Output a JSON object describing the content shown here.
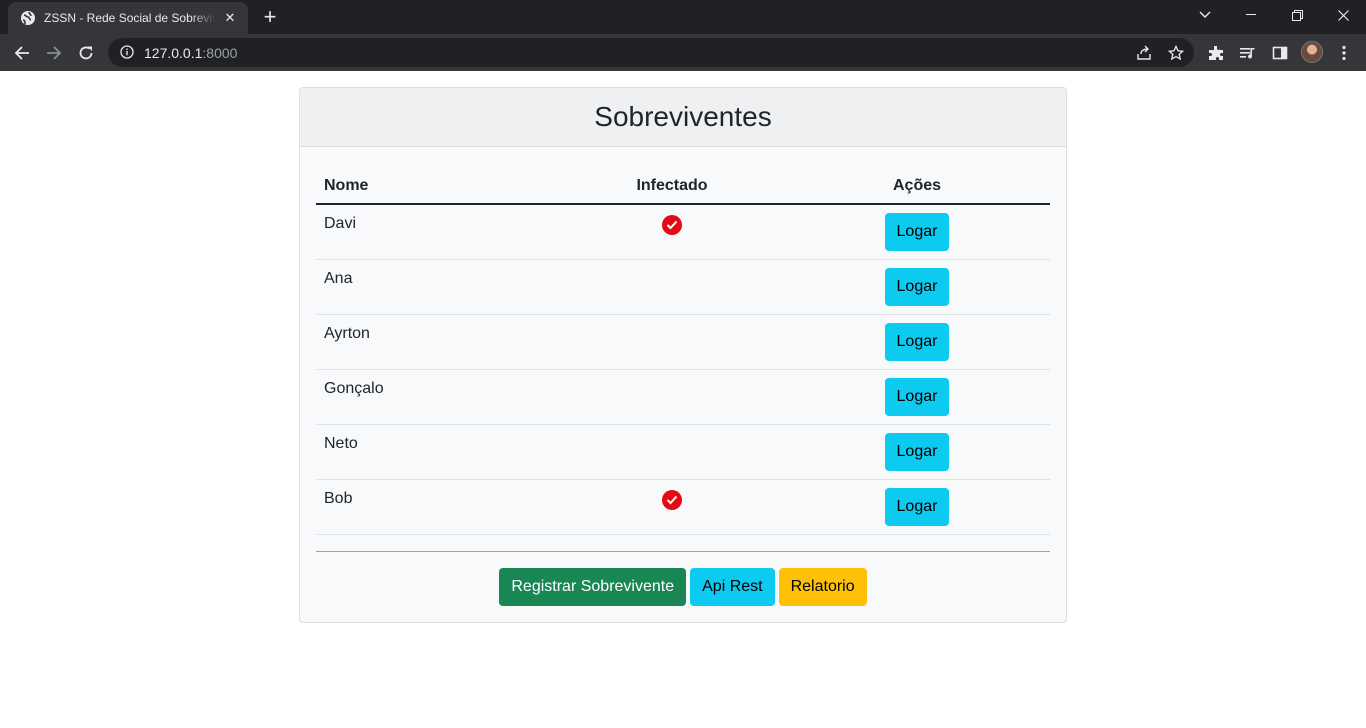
{
  "browser": {
    "tab_title": "ZSSN - Rede Social de Sobreviventes",
    "new_tab": "+",
    "url_host": "127.0.0.1",
    "url_port": ":8000"
  },
  "page": {
    "title": "Sobreviventes",
    "columns": {
      "name": "Nome",
      "infected": "Infectado",
      "actions": "Ações"
    },
    "rows": [
      {
        "name": "Davi",
        "infected": true,
        "action_label": "Logar"
      },
      {
        "name": "Ana",
        "infected": false,
        "action_label": "Logar"
      },
      {
        "name": "Ayrton",
        "infected": false,
        "action_label": "Logar"
      },
      {
        "name": "Gonçalo",
        "infected": false,
        "action_label": "Logar"
      },
      {
        "name": "Neto",
        "infected": false,
        "action_label": "Logar"
      },
      {
        "name": "Bob",
        "infected": true,
        "action_label": "Logar"
      }
    ],
    "buttons": {
      "register": "Registrar Sobrevivente",
      "api": "Api Rest",
      "report": "Relatorio"
    }
  },
  "colors": {
    "infected_check": "#e50914",
    "btn_info": "#0dcaf0",
    "btn_success": "#198754",
    "btn_warning": "#ffc107"
  }
}
